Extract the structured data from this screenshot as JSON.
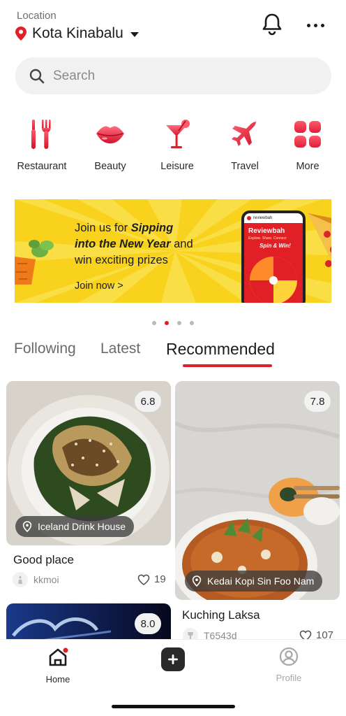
{
  "header": {
    "location_label": "Location",
    "city": "Kota Kinabalu"
  },
  "search": {
    "placeholder": "Search"
  },
  "categories": [
    {
      "label": "Restaurant",
      "icon": "fork-knife-icon"
    },
    {
      "label": "Beauty",
      "icon": "lips-icon"
    },
    {
      "label": "Leisure",
      "icon": "cocktail-icon"
    },
    {
      "label": "Travel",
      "icon": "airplane-icon"
    },
    {
      "label": "More",
      "icon": "grid-icon"
    }
  ],
  "banner": {
    "line1_a": "Join us for ",
    "line1_b": "Sipping",
    "line2_b": "into the New Year",
    "line2_c": " and",
    "line3": "win exciting prizes",
    "cta": "Join now >",
    "phone_app": "reviewbah",
    "phone_title": "Reviewbah",
    "phone_sub": "Explore. Share. Connect",
    "phone_spin": "Spin & Win!"
  },
  "carousel": {
    "count": 4,
    "active_index": 1
  },
  "tabs": [
    {
      "label": "Following",
      "active": false
    },
    {
      "label": "Latest",
      "active": false
    },
    {
      "label": "Recommended",
      "active": true
    }
  ],
  "feed": [
    {
      "score": "6.8",
      "place": "Iceland Drink House",
      "title": "Good place",
      "user": "kkmoi",
      "likes": "19"
    },
    {
      "score": "7.8",
      "place": "Kedai Kopi Sin Foo Nam",
      "title": "Kuching Laksa",
      "user": "T6543d",
      "likes": "107"
    },
    {
      "score": "8.0"
    }
  ],
  "nav": {
    "home": "Home",
    "profile": "Profile"
  },
  "colors": {
    "accent": "#e01f26",
    "banner": "#f9d21e"
  }
}
